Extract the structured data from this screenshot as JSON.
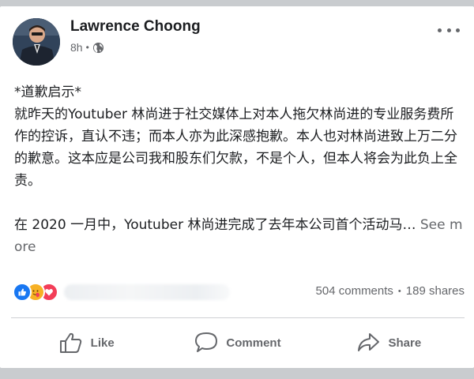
{
  "post": {
    "author": "Lawrence Choong",
    "time": "8h",
    "dot": "•",
    "paragraphs": [
      "*道歉启示*",
      "就昨天的Youtuber 林尚进于社交媒体上对本人拖欠林尚进的专业服务费所作的控诉，直认不违；而本人亦为此深感抱歉。本人也对林尚进致上万二分的歉意。这本应是公司我和股东们欠款，不是个人，但本人将会为此负上全责。"
    ],
    "truncated_text": "在 2020 一月中，Youtuber 林尚进完成了去年本公司首个活动马…",
    "see_more": "See more",
    "audience_icon": "globe-icon",
    "menu_icon": "more-horizontal-icon"
  },
  "engagement": {
    "reactions": [
      "like-reaction-icon",
      "care-reaction-icon",
      "love-reaction-icon"
    ],
    "comments": "504 comments",
    "separator": "•",
    "shares": "189 shares"
  },
  "actions": {
    "like": "Like",
    "comment": "Comment",
    "share": "Share"
  },
  "colors": {
    "background": "#c9cccf",
    "card": "#ffffff",
    "text": "#1c1e21",
    "secondary_text": "#65676b",
    "like_blue": "#1877f2",
    "care_yellow": "#f7b125",
    "love_red": "#f33e58"
  }
}
